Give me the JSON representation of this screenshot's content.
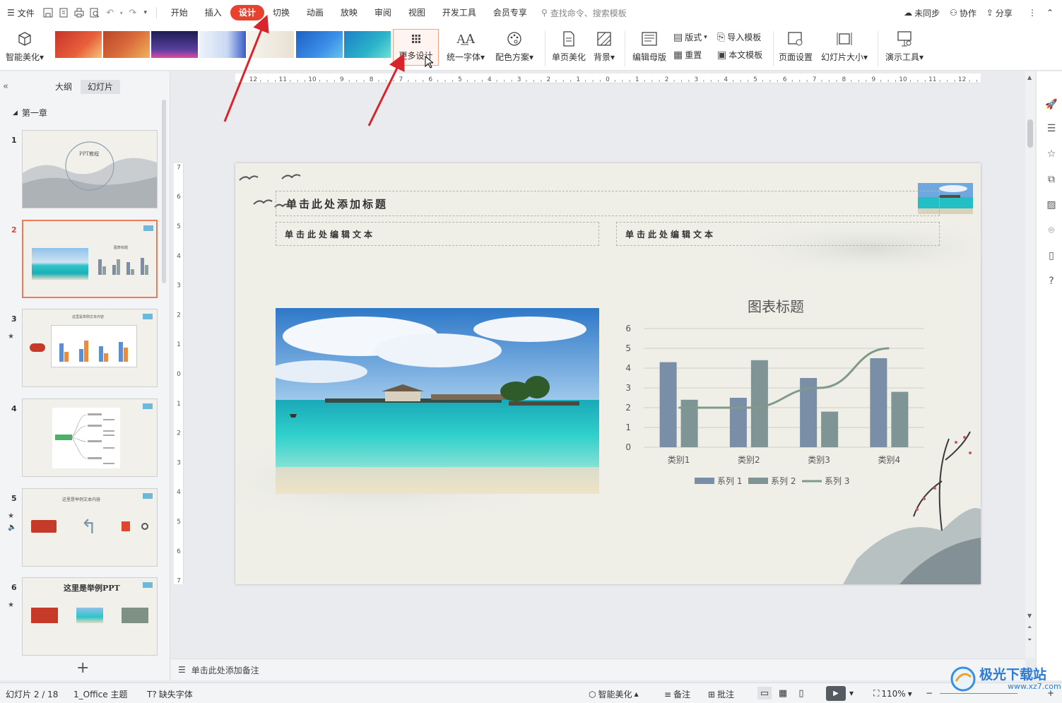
{
  "menubar": {
    "file_label": "文件",
    "tabs": [
      "开始",
      "插入",
      "设计",
      "切换",
      "动画",
      "放映",
      "审阅",
      "视图",
      "开发工具",
      "会员专享"
    ],
    "active_tab": "设计",
    "search_placeholder": "查找命令、搜索模板",
    "unsynced_label": "未同步",
    "collab_label": "协作",
    "share_label": "分享"
  },
  "ribbon": {
    "smart_beautify": "智能美化",
    "more_design": "更多设计",
    "unify_font": "统一字体",
    "color_scheme": "配色方案",
    "page_beautify": "单页美化",
    "background": "背景",
    "edit_master": "编辑母版",
    "layout": "版式",
    "reset": "重置",
    "import_template": "导入模板",
    "this_template": "本文模板",
    "page_setup": "页面设置",
    "slide_size": "幻灯片大小",
    "presenter_tools": "演示工具"
  },
  "left_panel": {
    "tab_outline": "大纲",
    "tab_slides": "幻灯片",
    "section_title": "第一章",
    "slides": [
      {
        "num": "1",
        "caption": "PPT教程"
      },
      {
        "num": "2",
        "caption": "图表标题"
      },
      {
        "num": "3",
        "caption": "这里是举例文本内容"
      },
      {
        "num": "4",
        "caption": ""
      },
      {
        "num": "5",
        "caption": "这里是举例文本内容"
      },
      {
        "num": "6",
        "caption": "这里是举例PPT"
      }
    ],
    "active_slide": 2
  },
  "slide": {
    "title_placeholder": "单击此处添加标题",
    "text_placeholder_left": "单击此处编辑文本",
    "text_placeholder_right": "单击此处编辑文本"
  },
  "chart_data": {
    "type": "bar",
    "title": "图表标题",
    "categories": [
      "类别1",
      "类别2",
      "类别3",
      "类别4"
    ],
    "series": [
      {
        "name": "系列 1",
        "type": "bar",
        "values": [
          4.3,
          2.5,
          3.5,
          4.5
        ],
        "color": "#7a8ea8"
      },
      {
        "name": "系列 2",
        "type": "bar",
        "values": [
          2.4,
          4.4,
          1.8,
          2.8
        ],
        "color": "#7f9494"
      },
      {
        "name": "系列 3",
        "type": "line",
        "values": [
          2,
          2,
          3,
          5
        ],
        "color": "#7f9a8a"
      }
    ],
    "ylim": [
      0,
      6
    ],
    "yticks": [
      0,
      1,
      2,
      3,
      4,
      5,
      6
    ],
    "grid": true,
    "legend": "bottom"
  },
  "notes": {
    "placeholder": "单击此处添加备注"
  },
  "statusbar": {
    "slide_counter": "幻灯片 2 / 18",
    "theme": "1_Office 主题",
    "missing_font": "缺失字体",
    "smart_beautify": "智能美化",
    "notes": "备注",
    "comments": "批注",
    "zoom": "110%"
  },
  "watermark": {
    "main": "极光下载站",
    "sub": "www.xz7.com"
  },
  "colors": {
    "accent": "#e8412e",
    "selection": "#f07a57"
  }
}
